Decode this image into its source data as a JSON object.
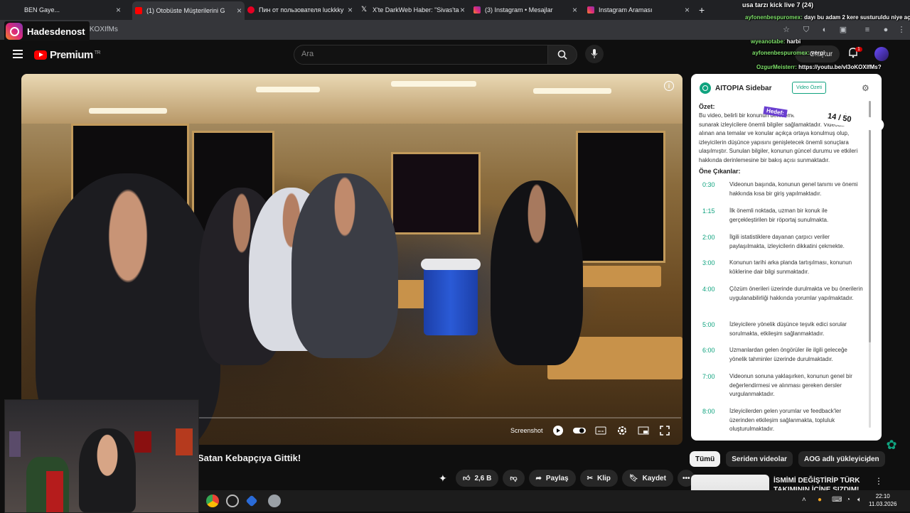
{
  "browser": {
    "tabs": [
      {
        "label": "(1) Otobüste Müşterilerini G",
        "favicon_color": "#ff0000",
        "active": true
      },
      {
        "label": "Пин от пользователя luckkky",
        "favicon_color": "#e60023",
        "active": false
      },
      {
        "label": "X'te DarkWeb Haber: \"Sivas'ta",
        "favicon_color": "#ffffff",
        "active": false
      },
      {
        "label": "(3) Instagram • Mesajlar",
        "favicon_color": "#dd2a7b",
        "active": false
      },
      {
        "label": "Instagram Araması",
        "favicon_color": "#dd2a7b",
        "active": false
      }
    ],
    "first_tab_label": "BEN Gaye...",
    "url": ".com/watch?v=vI3oKOXIfMs"
  },
  "youtube": {
    "logo_text": "Premium",
    "logo_region": "TR",
    "search_placeholder": "Ara",
    "create_label": "Oluştur",
    "notification_count": "1",
    "video_title": "Satan Kebapçıya Gittik!",
    "screenshot_label": "Screenshot",
    "like_count": "2,6 B",
    "share_label": "Paylaş",
    "clip_label": "Klip",
    "save_label": "Kaydet",
    "chips": [
      "Tümü",
      "Seriden videolar",
      "AOG adlı yükleyiciden"
    ],
    "rec_title": "İSMİMİ DEĞİŞTİRİP TÜRK TAKIMININ İÇİNE SIZDIM! Bi"
  },
  "aitopia": {
    "title": "AITOPIA Sidebar",
    "summary_button": "Video Özeti",
    "summary_heading": "Özet:",
    "summary_text": "Bu video, belirli bir konunun derinlemesine bir incelemesini sunarak izleyicilere önemli bilgiler sağlamaktadır. Videoda ele alınan ana temalar ve konular açıkça ortaya konulmuş olup, izleyicilerin düşünce yapısını genişletecek önemli sonuçlara ulaşılmıştır. Sunulan bilgiler, konunun güncel durumu ve etkileri hakkında derinlemesine bir bakış açısı sunmaktadır.",
    "highlights_heading": "Öne Çıkanlar:",
    "highlights": [
      {
        "time": "0:30",
        "text": "Videonun başında, konunun genel tanımı ve önemi hakkında kısa bir giriş yapılmaktadır."
      },
      {
        "time": "1:15",
        "text": "İlk önemli noktada, uzman bir konuk ile gerçekleştirilen bir röportaj sunulmakta."
      },
      {
        "time": "2:00",
        "text": "İlgili istatistiklere dayanan çarpıcı veriler paylaşılmakta, izleyicilerin dikkatini çekmekte."
      },
      {
        "time": "3:00",
        "text": "Konunun tarihi arka planda tartışılması, konunun köklerine dair bilgi sunmaktadır."
      },
      {
        "time": "4:00",
        "text": "Çözüm önerileri üzerinde durulmakta ve bu önerilerin uygulanabilirliği hakkında yorumlar yapılmaktadır."
      },
      {
        "time": "5:00",
        "text": "İzleyicilere yönelik düşünce teşvik edici sorular sorulmakta, etkileşim sağlanmaktadır."
      },
      {
        "time": "6:00",
        "text": "Uzmanlardan gelen öngörüler ile ilgili geleceğe yönelik tahminler üzerinde durulmaktadır."
      },
      {
        "time": "7:00",
        "text": "Videonun sonuna yaklaşırken, konunun genel bir değerlendirmesi ve alınması gereken dersler vurgulanmaktadır."
      },
      {
        "time": "8:00",
        "text": "İzleyicilerden gelen yorumlar ve feedback'ler üzerinden etkileşim sağlanmakta, topluluk oluşturulmaktadır."
      }
    ]
  },
  "stream": {
    "instagram_handle": "Hadesdenost",
    "chat": [
      {
        "user": "",
        "text": "usa tarzı kick live 7 (24)"
      },
      {
        "user": "ayfonenbespuromex:",
        "text": "dayı bu adam 2 kere susturuldu niye açıldı?"
      },
      {
        "user": "wyeanotabe:",
        "text": "harbi"
      },
      {
        "user": "ayfonenbespuromex:",
        "text": "vergi"
      },
      {
        "user": "OzgurMeisterr:",
        "text": "https://youtu.be/vI3oKOXIfMs?"
      }
    ],
    "goal_label": "Hedef:",
    "goal_value": "14 / 50"
  },
  "taskbar": {
    "time": "22:10",
    "date": "11.03.2026"
  }
}
